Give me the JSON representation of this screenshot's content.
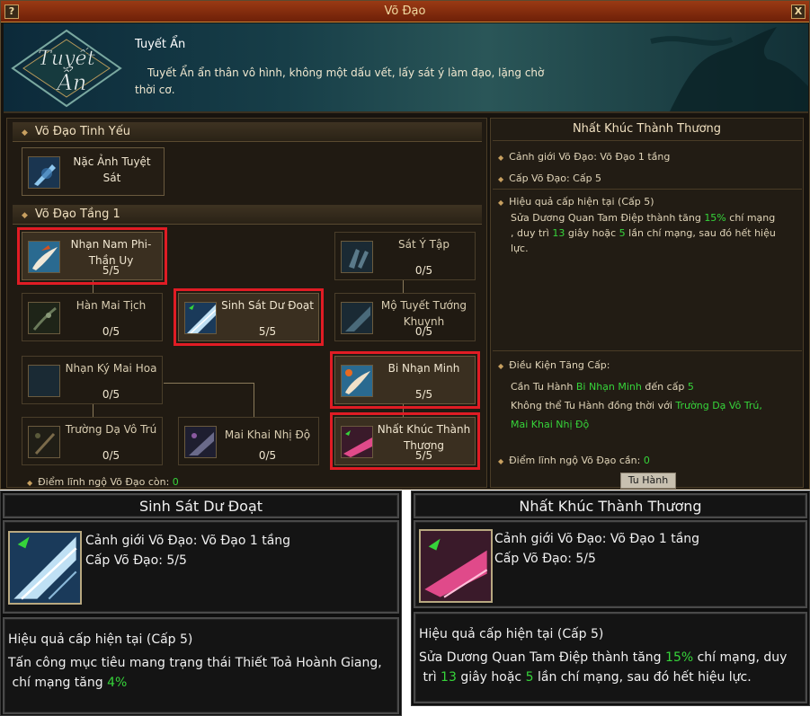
{
  "window": {
    "title": "Võ Đạo",
    "help_label": "?",
    "close_label": "X"
  },
  "banner": {
    "logo_text_1": "Tuyết",
    "logo_text_2": "Ẩn",
    "sect_name": "Tuyết Ẩn",
    "sect_desc": "Tuyết Ẩn ẩn thân vô hình, không một dấu vết, lấy sát ý làm đạo, lặng chờ thời cơ."
  },
  "left_panel": {
    "section_essence": "Võ Đạo Tinh Yếu",
    "section_tier1": "Võ Đạo Tầng 1",
    "essence_skill": {
      "name": "Nặc Ảnh Tuyệt Sát"
    },
    "skills": [
      {
        "name": "Nhạn Nam Phi-Thần Uy",
        "level": "5/5"
      },
      {
        "name": "Sát Ý Tập",
        "level": "0/5"
      },
      {
        "name": "Hàn Mai Tịch",
        "level": "0/5"
      },
      {
        "name": "Sinh Sát Dư Đoạt",
        "level": "5/5"
      },
      {
        "name": "Mộ Tuyết Tướng Khuynh",
        "level": "0/5"
      },
      {
        "name": "Nhạn Ký Mai Hoa",
        "level": "0/5"
      },
      {
        "name": "Bi Nhạn Minh",
        "level": "5/5"
      },
      {
        "name": "Trường Dạ Vô Trú",
        "level": "0/5"
      },
      {
        "name": "Mai Khai Nhị Độ",
        "level": "0/5"
      },
      {
        "name": "Nhất Khúc Thành Thương",
        "level": "5/5"
      }
    ],
    "remain_label": "Điểm lĩnh ngộ Võ Đạo còn:",
    "remain_value": "0"
  },
  "right_panel": {
    "title": "Nhất Khúc Thành Thương",
    "realm": "Cảnh giới Võ Đạo: Võ Đạo 1 tầng",
    "level": "Cấp Võ Đạo: Cấp 5",
    "effect_head": "Hiệu quả cấp hiện tại (Cấp 5)",
    "effect_1": "Sửa Dương Quan Tam Điệp thành tăng",
    "effect_pct": "15%",
    "effect_2": "chí mạng",
    "effect_3": ", duy trì",
    "effect_secs": "13",
    "effect_4": "giây hoặc",
    "effect_times": "5",
    "effect_5": "lần chí mạng, sau đó hết hiệu",
    "effect_6": "lực.",
    "req_head": "Điều Kiện Tăng Cấp:",
    "req_1a": "Cần Tu Hành",
    "req_1b": "Bi Nhạn Minh",
    "req_1c": "đến cấp",
    "req_1d": "5",
    "req_2a": "Không thể Tu Hành đồng thời với",
    "req_2b": "Trường Dạ Vô Trú,",
    "req_2c": "Mai Khai Nhị Độ",
    "points_label": "Điểm lĩnh ngộ Võ Đạo cần:",
    "points_value": "0",
    "train_button": "Tu Hành"
  },
  "tooltip_left": {
    "title": "Sinh Sát Dư Đoạt",
    "realm": "Cảnh giới Võ Đạo: Võ Đạo 1 tầng",
    "level": "Cấp Võ Đạo: 5/5",
    "effect_head": "Hiệu quả cấp hiện tại (Cấp 5)",
    "effect_1": "Tấn công mục tiêu mang trạng thái Thiết Toả Hoành Giang,",
    "effect_2": "chí mạng tăng",
    "effect_pct": "4%"
  },
  "tooltip_right": {
    "title": "Nhất Khúc Thành Thương",
    "realm": "Cảnh giới Võ Đạo: Võ Đạo 1 tầng",
    "level": "Cấp Võ Đạo: 5/5",
    "effect_head": "Hiệu quả cấp hiện tại (Cấp 5)",
    "effect_1": "Sửa Dương Quan Tam Điệp thành tăng",
    "effect_pct": "15%",
    "effect_2": "chí mạng, duy",
    "effect_3": "trì",
    "effect_secs": "13",
    "effect_4": "giây hoặc",
    "effect_times": "5",
    "effect_5": "lần chí mạng, sau đó hết hiệu lực."
  },
  "colors": {
    "highlight": "#e01c24",
    "value_green": "#36d43a",
    "title_bar": "#8a2e0e"
  }
}
